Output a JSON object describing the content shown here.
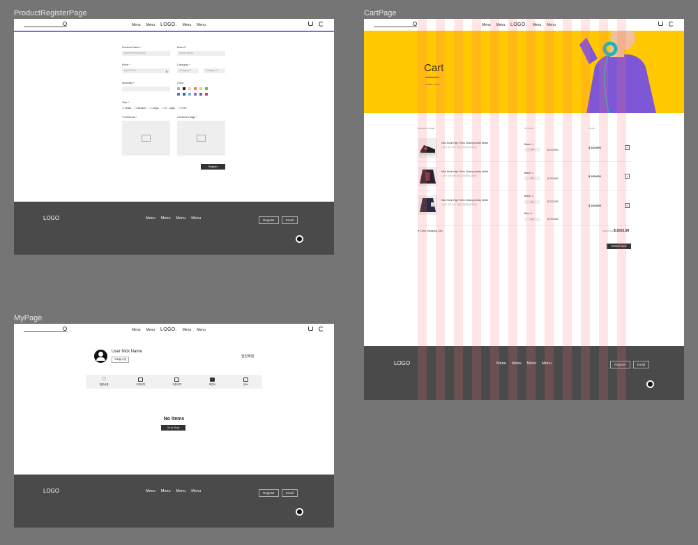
{
  "frames": {
    "register_label": "ProductRegisterPage",
    "cart_label": "CartPage",
    "mypage_label": "MyPage"
  },
  "header": {
    "menu_items": [
      "Menu",
      "Menu",
      "Menu",
      "Menu"
    ],
    "logo": "LOGO."
  },
  "footer": {
    "logo": "LOGO",
    "menu_items": [
      "Menu",
      "Menu",
      "Menu",
      "Menu"
    ],
    "register_label": "Register",
    "email_label": "Email"
  },
  "register": {
    "product_name_label": "Product Name *",
    "product_name_placeholder": "Input Product Name",
    "brand_label": "Brand *",
    "brand_placeholder": "Select Brand",
    "price_label": "Price *",
    "price_placeholder": "Input Price",
    "price_unit": "$",
    "category_label": "Category *",
    "category1": "Category 1",
    "category2": "Category 2",
    "quantity_label": "Quantity *",
    "color_label": "Color",
    "size_label": "Size *",
    "sizes": [
      "Small",
      "Medium",
      "Large",
      "X - Large",
      "Free"
    ],
    "thumbnail_label": "Thumbnail *",
    "content_image_label": "Content Image *",
    "submit_label": "Register",
    "swatch_colors": [
      "#b0b0b0",
      "#222222",
      "#f7c6c6",
      "#f07b4a",
      "#f5d04a",
      "#5bbf56",
      "#3f7fd6",
      "#3a56c4",
      "#6fb3e8",
      "#9b5ec9",
      "#6a6a6a",
      "#e0397d"
    ]
  },
  "cart": {
    "title": "Cart",
    "breadcrumb": "HOME > CART",
    "col_product": "PRODUCT NAME",
    "col_options": "OPTIONS",
    "col_total": "TOTAL",
    "rows": [
      {
        "name": "Nike Dunk High Retro Championship White",
        "sub": "나이키 덩크 하이 레트로 챔피언십 화이트",
        "options": [
          {
            "label": "Black / L",
            "qty": "10",
            "price": "$ 223,000"
          }
        ],
        "total": "$ 223,000"
      },
      {
        "name": "Nike Dunk High Retro Championship White",
        "sub": "나이키 덩크 하이 레트로 챔피언십 화이트",
        "options": [
          {
            "label": "Black / L",
            "qty": "10",
            "price": "$ 223,000"
          }
        ],
        "total": "$ 223,000"
      },
      {
        "name": "Nike Dunk High Retro Championship White",
        "sub": "나이키 덩크 하이 레트로 챔피언십 화이트",
        "options": [
          {
            "label": "Black / L",
            "qty": "10",
            "price": "$ 223,000"
          },
          {
            "label": "Blue / L",
            "qty": "10",
            "price": "$ 223,000"
          }
        ],
        "total": "$ 223,000"
      }
    ],
    "clear_label": "Clear Shopping Cart",
    "subtotal_label": "SUBTOTAL",
    "subtotal_value": "$ 2602.00",
    "order_label": "ORDER NOW"
  },
  "mypage": {
    "nickname": "User Nick Name",
    "edit_profile": "프로필 수정",
    "grade": "일반회원",
    "menu_items": [
      "찜한상품",
      "구매내역",
      "리뷰내역",
      "포인트",
      "Q&A"
    ],
    "empty_title": "No Items",
    "go_shop": "Go to Shop"
  }
}
